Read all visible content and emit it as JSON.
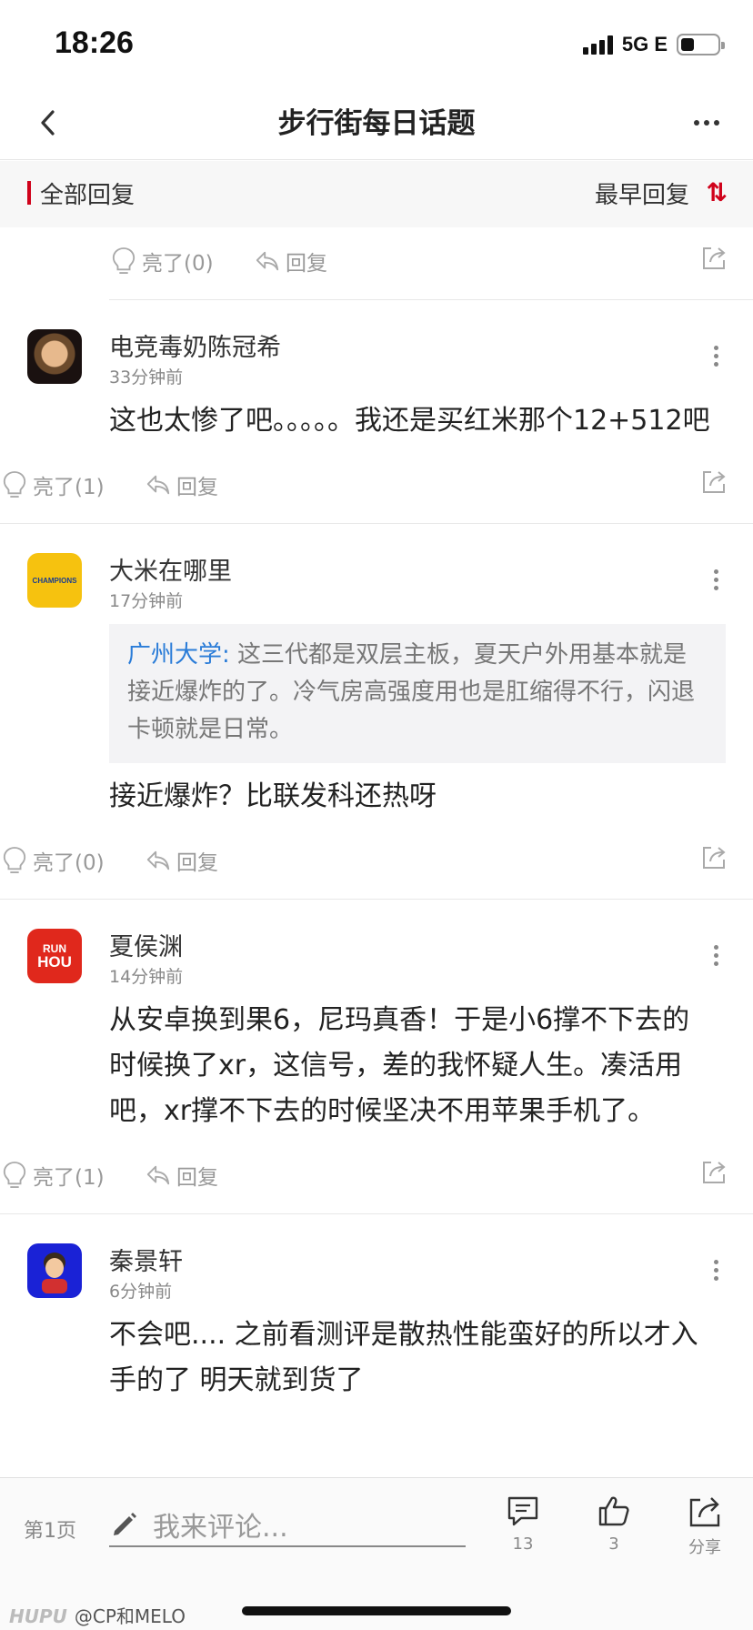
{
  "status": {
    "time": "18:26",
    "network": "5G E"
  },
  "nav": {
    "title": "步行街每日话题"
  },
  "filter": {
    "all_label": "全部回复",
    "sort_label": "最早回复",
    "sort_icon": "⇅"
  },
  "labels": {
    "reply": "回复"
  },
  "top_actions": {
    "like": "亮了(0)"
  },
  "posts": [
    {
      "name": "电竞毒奶陈冠希",
      "time": "33分钟前",
      "body": "这也太惨了吧。。。。。我还是买红米那个12+512吧",
      "like": "亮了(1)"
    },
    {
      "name": "大米在哪里",
      "time": "17分钟前",
      "quote_name": "广州大学:",
      "quote_text": " 这三代都是双层主板，夏天户外用基本就是接近爆炸的了。冷气房高强度用也是肛缩得不行，闪退卡顿就是日常。",
      "body": "接近爆炸？比联发科还热呀",
      "like": "亮了(0)",
      "avatar_text": "CHAMPIONS"
    },
    {
      "name": "夏侯渊",
      "time": "14分钟前",
      "body": "从安卓换到果6，尼玛真香！于是小6撑不下去的时候换了xr，这信号，差的我怀疑人生。凑活用吧，xr撑不下去的时候坚决不用苹果手机了。",
      "like": "亮了(1)",
      "avatar_top": "RUN",
      "avatar_bottom": "HOU"
    },
    {
      "name": "秦景轩",
      "time": "6分钟前",
      "body": "不会吧.... 之前看测评是散热性能蛮好的所以才入手的了 明天就到货了"
    }
  ],
  "bottom": {
    "page": "第1页",
    "placeholder": "我来评论...",
    "comments": "13",
    "likes": "3",
    "share": "分享",
    "watermark_brand": "HUPU",
    "watermark_user": "@CP和MELO"
  }
}
